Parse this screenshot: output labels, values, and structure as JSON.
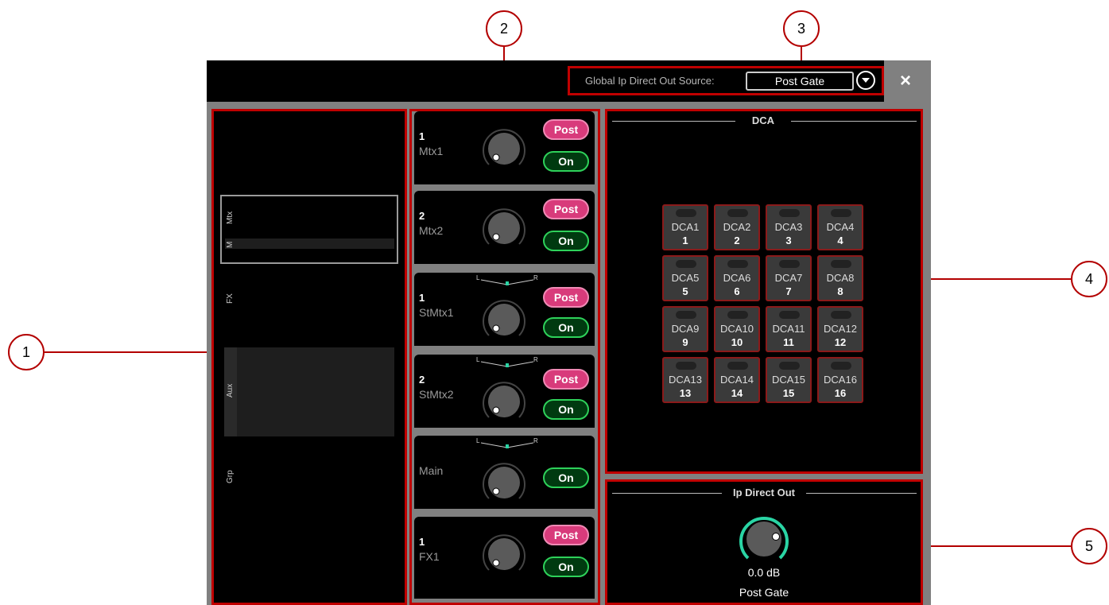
{
  "header": {
    "source_label": "Global Ip Direct Out Source:",
    "source_value": "Post Gate",
    "close_label": "×"
  },
  "callouts": [
    "1",
    "2",
    "3",
    "4",
    "5"
  ],
  "tabs": [
    {
      "label": "Mtx"
    },
    {
      "label": "M"
    },
    {
      "label": "FX"
    },
    {
      "label": "Aux"
    },
    {
      "label": "Grp"
    }
  ],
  "strips": [
    {
      "num": "1",
      "name": "Mtx1",
      "post": "Post",
      "on": "On",
      "pan": false
    },
    {
      "num": "2",
      "name": "Mtx2",
      "post": "Post",
      "on": "On",
      "pan": false
    },
    {
      "num": "1",
      "name": "StMtx1",
      "post": "Post",
      "on": "On",
      "pan": true
    },
    {
      "num": "2",
      "name": "StMtx2",
      "post": "Post",
      "on": "On",
      "pan": true
    },
    {
      "num": "",
      "name": "Main",
      "post": "",
      "on": "On",
      "pan": true
    },
    {
      "num": "1",
      "name": "FX1",
      "post": "Post",
      "on": "On",
      "pan": false
    }
  ],
  "pan_labels": {
    "left": "L",
    "right": "R"
  },
  "dca": {
    "title": "DCA",
    "items": [
      {
        "name": "DCA1",
        "num": "1"
      },
      {
        "name": "DCA2",
        "num": "2"
      },
      {
        "name": "DCA3",
        "num": "3"
      },
      {
        "name": "DCA4",
        "num": "4"
      },
      {
        "name": "DCA5",
        "num": "5"
      },
      {
        "name": "DCA6",
        "num": "6"
      },
      {
        "name": "DCA7",
        "num": "7"
      },
      {
        "name": "DCA8",
        "num": "8"
      },
      {
        "name": "DCA9",
        "num": "9"
      },
      {
        "name": "DCA10",
        "num": "10"
      },
      {
        "name": "DCA11",
        "num": "11"
      },
      {
        "name": "DCA12",
        "num": "12"
      },
      {
        "name": "DCA13",
        "num": "13"
      },
      {
        "name": "DCA14",
        "num": "14"
      },
      {
        "name": "DCA15",
        "num": "15"
      },
      {
        "name": "DCA16",
        "num": "16"
      }
    ]
  },
  "direct_out": {
    "title": "Ip Direct Out",
    "level": "0.0 dB",
    "source": "Post Gate"
  },
  "colors": {
    "callout_red": "#b30000",
    "post_pink": "#d83b7b",
    "on_green": "#2ed15a",
    "knob_teal": "#2ad4a4"
  }
}
